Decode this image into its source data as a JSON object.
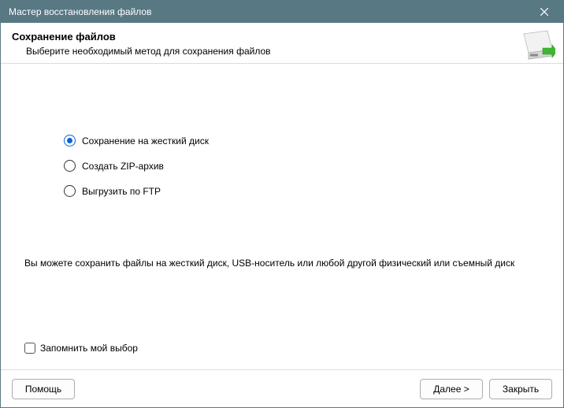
{
  "titlebar": {
    "title": "Мастер восстановления файлов"
  },
  "header": {
    "title": "Сохранение файлов",
    "subtitle": "Выберите необходимый метод для сохранения файлов"
  },
  "options": {
    "opt1": "Сохранение на жесткий диск",
    "opt2": "Создать ZIP-архив",
    "opt3": "Выгрузить по FTP",
    "selected": 0
  },
  "description": "Вы можете сохранить файлы на жесткий диск, USB-носитель или любой другой физический или съемный диск",
  "remember": {
    "label": "Запомнить мой выбор",
    "checked": false
  },
  "footer": {
    "help": "Помощь",
    "next": "Далее >",
    "close": "Закрыть"
  }
}
